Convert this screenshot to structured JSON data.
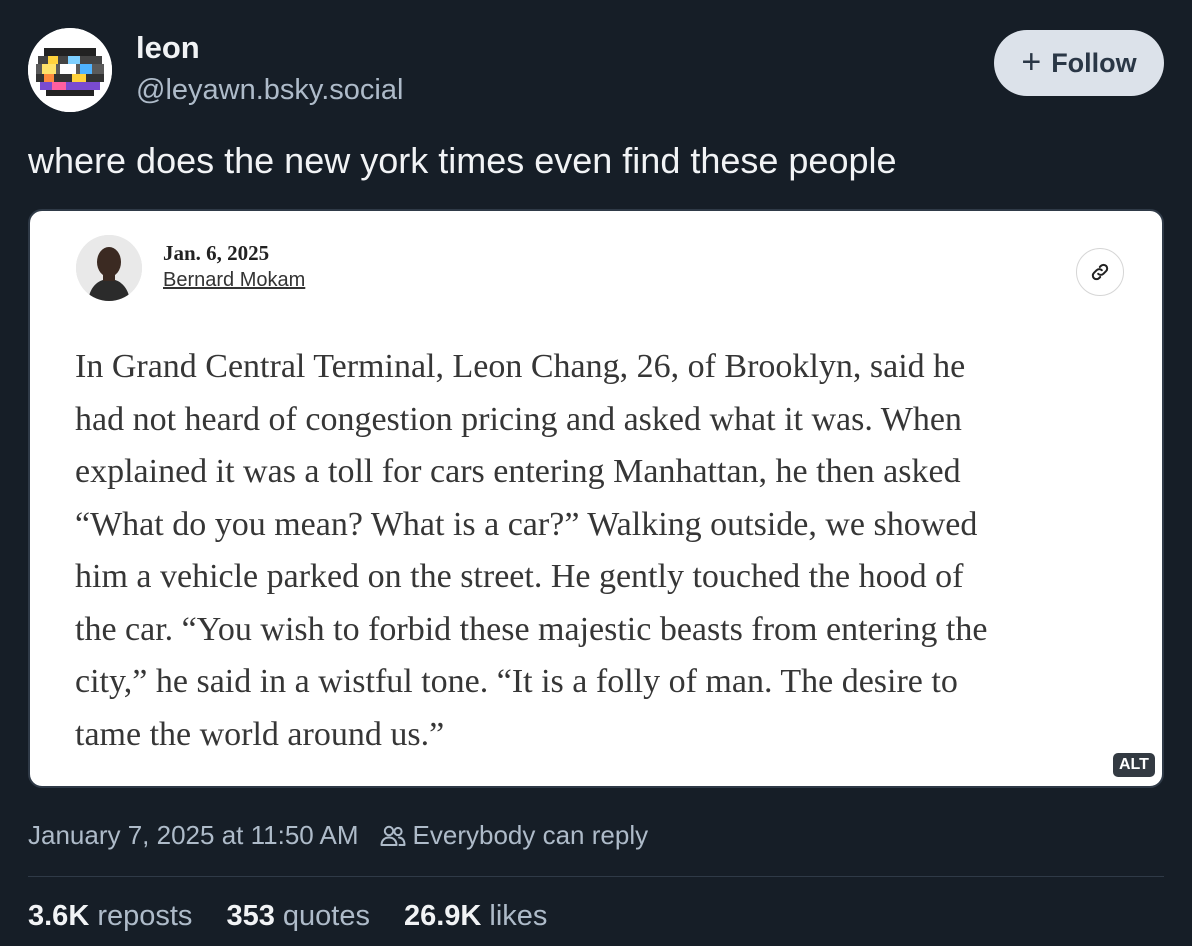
{
  "post": {
    "author": {
      "display_name": "leon",
      "handle": "@leyawn.bsky.social"
    },
    "follow_label": "Follow",
    "text": "where does the new york times even find these people",
    "embed": {
      "date": "Jan. 6, 2025",
      "byline": "Bernard Mokam",
      "body_lines": [
        "In Grand Central Terminal, Leon Chang, 26, of Brooklyn, said he",
        "had not heard of congestion pricing and asked what it was. When",
        "explained it was a toll for cars entering Manhattan, he then asked",
        "“What do you mean? What is a car?” Walking outside, we showed",
        "him a vehicle parked on the street. He gently touched the hood of",
        "the car. “You wish to forbid these majestic beasts from entering the",
        "city,” he said in a wistful tone. “It is a folly of man. The desire to",
        "tame the world around us.”"
      ],
      "alt_badge": "ALT"
    },
    "timestamp": "January 7, 2025 at 11:50 AM",
    "reply_setting": "Everybody can reply",
    "stats": {
      "reposts_count": "3.6K",
      "reposts_label": "reposts",
      "quotes_count": "353",
      "quotes_label": "quotes",
      "likes_count": "26.9K",
      "likes_label": "likes"
    }
  },
  "colors": {
    "background": "#161e27",
    "primary_text": "#f1f3f5",
    "secondary_text": "#aebbc9",
    "follow_button_bg": "#dce2ea",
    "embed_bg": "#ffffff"
  },
  "icons": {
    "follow": "plus-icon",
    "link": "link-icon",
    "reply_setting": "people-icon"
  }
}
